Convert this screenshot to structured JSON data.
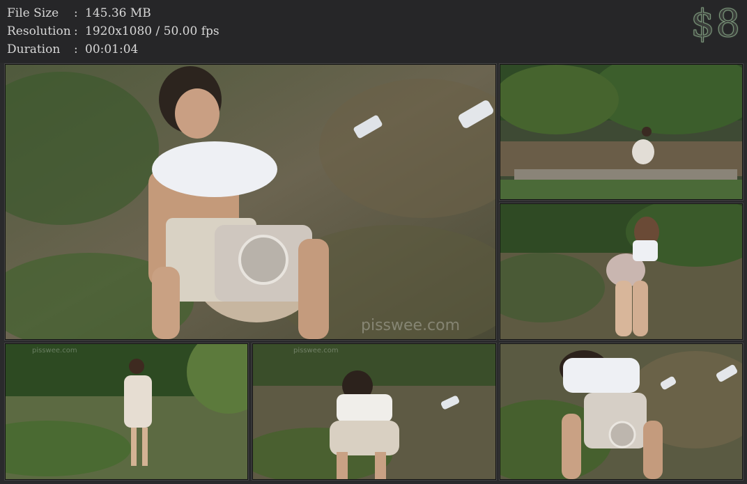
{
  "info": {
    "file_size_label": "File Size",
    "file_size_value": "145.36 MB",
    "resolution_label": "Resolution",
    "resolution_value": "1920x1080 / 50.00 fps",
    "duration_label": "Duration",
    "duration_value": "00:01:04",
    "separator": ":"
  },
  "price": "$8",
  "thumbnails": {
    "main_watermark": "pisswee.com",
    "small_watermark": "pisswee.com"
  },
  "colors": {
    "background": "#2a2a2c",
    "text": "#d8d8d8",
    "price_outline": "#7e9a7e"
  }
}
